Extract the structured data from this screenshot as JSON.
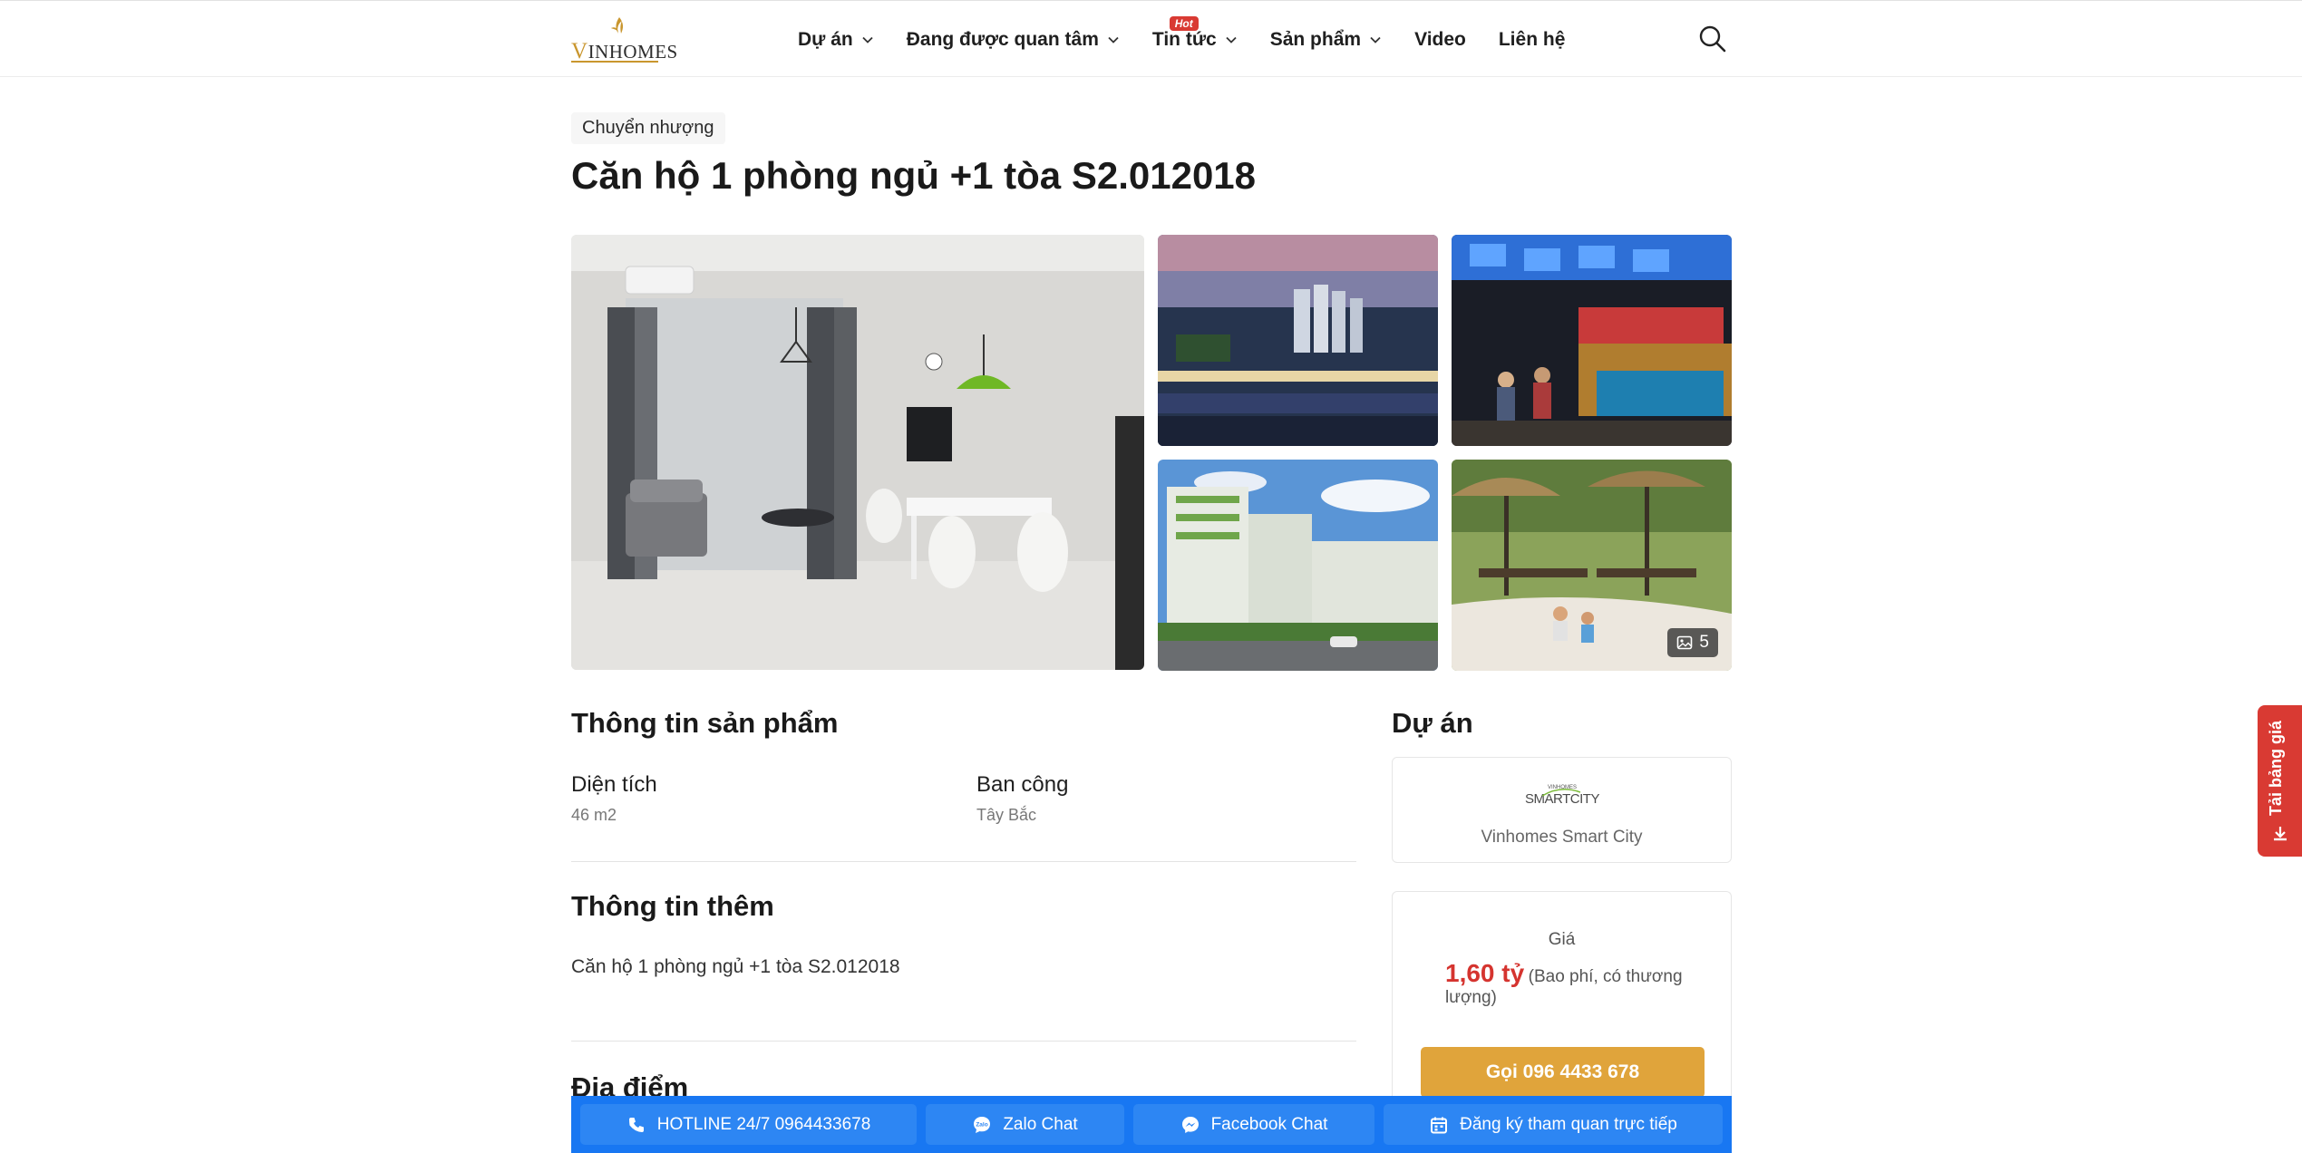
{
  "header": {
    "logo_text": "VINHOMES",
    "nav": [
      {
        "label": "Dự án",
        "has_dropdown": true
      },
      {
        "label": "Đang được quan tâm",
        "has_dropdown": true,
        "badge": "Hot"
      },
      {
        "label": "Tin tức",
        "has_dropdown": true
      },
      {
        "label": "Sản phẩm",
        "has_dropdown": true
      },
      {
        "label": "Video",
        "has_dropdown": false
      },
      {
        "label": "Liên hệ",
        "has_dropdown": false
      }
    ],
    "search_icon": "search-icon"
  },
  "breadcrumb": {
    "tag": "Chuyển nhượng"
  },
  "page_title": "Căn hộ 1 phòng ngủ +1 tòa S2.012018",
  "gallery": {
    "photo_count": "5"
  },
  "product_info": {
    "heading": "Thông tin sản phẩm",
    "fields": [
      {
        "label": "Diện tích",
        "value": "46 m2"
      },
      {
        "label": "Ban công",
        "value": "Tây Bắc"
      }
    ]
  },
  "extra_info": {
    "heading": "Thông tin thêm",
    "text": "Căn hộ 1 phòng ngủ +1 tòa S2.012018"
  },
  "location": {
    "heading": "Địa điểm"
  },
  "project": {
    "heading": "Dự án",
    "logo_text": "SMARTCITY",
    "logo_small": "VINHOMES",
    "name": "Vinhomes Smart City"
  },
  "price": {
    "label": "Giá",
    "value": "1,60 tỷ",
    "note": "(Bao phí, có thương lượng)",
    "call_button": "Gọi 096 4433 678"
  },
  "side_tab": {
    "label": "Tải bảng giá"
  },
  "bottom_bar": {
    "hotline": "HOTLINE 24/7 0964433678",
    "zalo": "Zalo Chat",
    "facebook": "Facebook Chat",
    "register": "Đăng ký tham quan trực tiếp"
  },
  "colors": {
    "accent_red": "#d5342f",
    "gold": "#e0a43b",
    "bar_blue": "#1877f2"
  }
}
